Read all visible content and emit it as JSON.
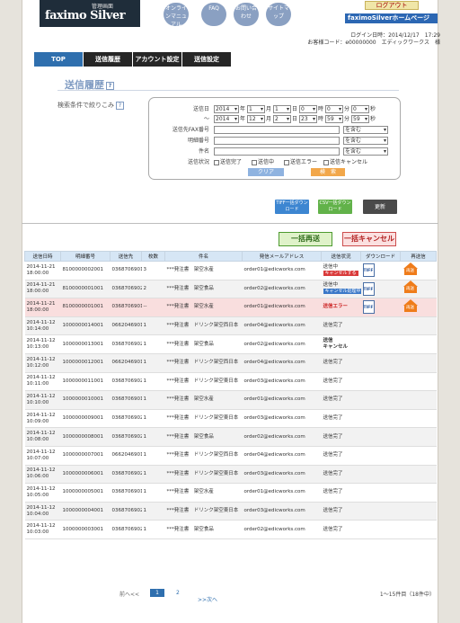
{
  "header": {
    "logo_sub": "管理画面",
    "logo_main": "faximo Silver",
    "nav": [
      "オンラインマニュアル",
      "FAQ",
      "お問い合わせ",
      "サイトマップ"
    ],
    "logout": "ログアウト",
    "home": "faximoSilverホームページ",
    "login_datetime": "ログイン日時：2014/12/17　17:29",
    "customer": "お客様コード：e00000000　エディックワークス　様"
  },
  "tabs": [
    "TOP",
    "送信履歴",
    "アカウント設定",
    "送信設定"
  ],
  "page_title": "送信履歴",
  "filter": {
    "label": "検索条件で絞りこみ",
    "send_date_label": "送信日",
    "from": {
      "year": "2014",
      "month": "1",
      "day": "1",
      "hour": "0",
      "min": "0",
      "sec": "0"
    },
    "to": {
      "year": "2014",
      "month": "12",
      "day": "2",
      "hour": "23",
      "min": "59",
      "sec": "59"
    },
    "units": {
      "year": "年",
      "month": "月",
      "day": "日",
      "hour": "時",
      "min": "分",
      "sec": "秒"
    },
    "tilde": "〜",
    "fax_label": "送信先FAX番号",
    "detail_label": "明細番号",
    "subject_label": "件名",
    "contains": "を含む",
    "status_label": "送信状況",
    "statuses": [
      "送信完了",
      "送信中",
      "送信エラー",
      "送信キャンセル"
    ],
    "clear": "クリア",
    "search": "検　索"
  },
  "actions": {
    "tiff_dl": "TIFF一括ダウンロード",
    "csv_dl": "CSV一括ダウンロード",
    "refresh": "更新",
    "resend_all": "一括再送",
    "cancel_all": "一括キャンセル"
  },
  "table": {
    "headers": [
      "送信日時",
      "明細番号",
      "送信先",
      "枚数",
      "件名",
      "発信メールアドレス",
      "送信状況",
      "ダウンロード",
      "再送信"
    ],
    "rows": [
      {
        "date": "2014-11-21",
        "time": "18:00:00",
        "id": "8100000002001",
        "to": "03687069012",
        "pages": "3",
        "subject": "***発注書　架空水産",
        "email": "order01@edicworks.com",
        "status": "送信中",
        "sub": "キャンセルする",
        "dl": "TIFF",
        "resend": "再送"
      },
      {
        "date": "2014-11-21",
        "time": "18:00:00",
        "id": "8100000001001",
        "to": "03687069023",
        "pages": "2",
        "subject": "***発注書　架空食品",
        "email": "order02@edicworks.com",
        "status": "送信中",
        "sub": "キャンセル処理中",
        "dl": "TIFF",
        "resend": "再送"
      },
      {
        "date": "2014-11-21",
        "time": "18:00:00",
        "id": "8100000001001",
        "to": "03687069012",
        "pages": "--",
        "subject": "***発注書　架空水産",
        "email": "order01@edicworks.com",
        "status": "送信エラー",
        "sub": "",
        "dl": "TIFF",
        "resend": "再送"
      },
      {
        "date": "2014-11-12",
        "time": "10:14:00",
        "id": "1000000014001",
        "to": "06620469019",
        "pages": "1",
        "subject": "***発注書　ドリンク架空西日本",
        "email": "order04@edicworks.com",
        "status": "送信完了",
        "sub": "",
        "dl": "",
        "resend": ""
      },
      {
        "date": "2014-11-12",
        "time": "10:13:00",
        "id": "1000000013001",
        "to": "03687069020",
        "pages": "1",
        "subject": "***発注書　架空食品",
        "email": "order02@edicworks.com",
        "status": "送信",
        "sub": "キャンセル",
        "dl": "",
        "resend": ""
      },
      {
        "date": "2014-11-12",
        "time": "10:12:00",
        "id": "1000000012001",
        "to": "06620469019",
        "pages": "1",
        "subject": "***発注書　ドリンク架空西日本",
        "email": "order04@edicworks.com",
        "status": "送信完了",
        "sub": "",
        "dl": "",
        "resend": ""
      },
      {
        "date": "2014-11-12",
        "time": "10:11:00",
        "id": "1000000011001",
        "to": "03687069020",
        "pages": "1",
        "subject": "***発注書　ドリンク架空東日本",
        "email": "order03@edicworks.com",
        "status": "送信完了",
        "sub": "",
        "dl": "",
        "resend": ""
      },
      {
        "date": "2014-11-12",
        "time": "10:10:00",
        "id": "1000000010001",
        "to": "03687069012",
        "pages": "1",
        "subject": "***発注書　架空水産",
        "email": "order01@edicworks.com",
        "status": "送信完了",
        "sub": "",
        "dl": "",
        "resend": ""
      },
      {
        "date": "2014-11-12",
        "time": "10:09:00",
        "id": "1000000009001",
        "to": "03687069020",
        "pages": "1",
        "subject": "***発注書　ドリンク架空東日本",
        "email": "order03@edicworks.com",
        "status": "送信完了",
        "sub": "",
        "dl": "",
        "resend": ""
      },
      {
        "date": "2014-11-12",
        "time": "10:08:00",
        "id": "1000000008001",
        "to": "03687069023",
        "pages": "1",
        "subject": "***発注書　架空食品",
        "email": "order02@edicworks.com",
        "status": "送信完了",
        "sub": "",
        "dl": "",
        "resend": ""
      },
      {
        "date": "2014-11-12",
        "time": "10:07:00",
        "id": "1000000007001",
        "to": "06620469019",
        "pages": "1",
        "subject": "***発注書　ドリンク架空西日本",
        "email": "order04@edicworks.com",
        "status": "送信完了",
        "sub": "",
        "dl": "",
        "resend": ""
      },
      {
        "date": "2014-11-12",
        "time": "10:06:00",
        "id": "1000000006001",
        "to": "03687069020",
        "pages": "1",
        "subject": "***発注書　ドリンク架空東日本",
        "email": "order03@edicworks.com",
        "status": "送信完了",
        "sub": "",
        "dl": "",
        "resend": ""
      },
      {
        "date": "2014-11-12",
        "time": "10:05:00",
        "id": "1000000005001",
        "to": "03687069012",
        "pages": "1",
        "subject": "***発注書　架空水産",
        "email": "order01@edicworks.com",
        "status": "送信完了",
        "sub": "",
        "dl": "",
        "resend": ""
      },
      {
        "date": "2014-11-12",
        "time": "10:04:00",
        "id": "1000000004001",
        "to": "03687069020",
        "pages": "1",
        "subject": "***発注書　ドリンク架空東日本",
        "email": "order03@edicworks.com",
        "status": "送信完了",
        "sub": "",
        "dl": "",
        "resend": ""
      },
      {
        "date": "2014-11-12",
        "time": "10:03:00",
        "id": "1000000003001",
        "to": "03687069023",
        "pages": "1",
        "subject": "***発注書　架空食品",
        "email": "order02@edicworks.com",
        "status": "送信完了",
        "sub": "",
        "dl": "",
        "resend": ""
      }
    ]
  },
  "pager": {
    "prev": "前へ<<",
    "page1": "1",
    "page2": "2",
    "next": ">>次へ",
    "count": "1〜15件目（18件中）"
  }
}
